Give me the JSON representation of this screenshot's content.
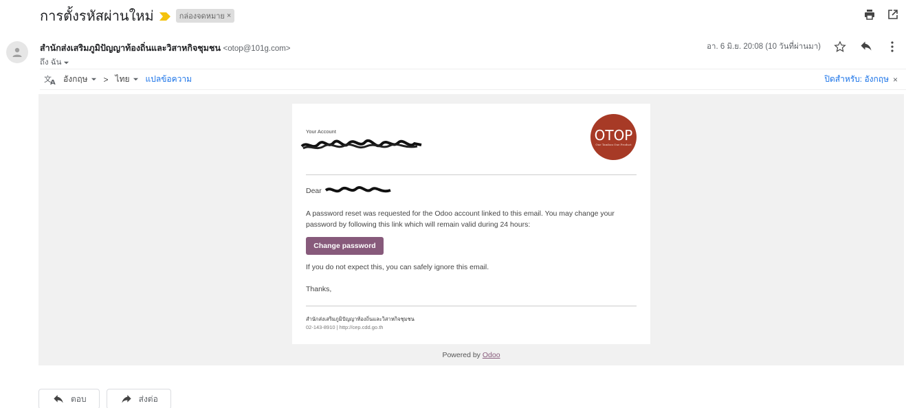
{
  "subject": "การตั้งรหัสผ่านใหม่",
  "label_chip": {
    "text": "กล่องจดหมาย",
    "close": "×"
  },
  "sender": {
    "name": "สำนักส่งเสริมภูมิปัญญาท้องถิ่นและวิสาหกิจชุมชน",
    "email": "<otop@101g.com>",
    "to": "ถึง ฉัน"
  },
  "date": "อา. 6 มิ.ย. 20:08 (10 วันที่ผ่านมา)",
  "translate": {
    "from_lang": "อังกฤษ",
    "arrow": ">",
    "to_lang": "ไทย",
    "action": "แปลข้อความ",
    "turn_off": "ปิดสำหรับ: อังกฤษ",
    "close": "×"
  },
  "email_body": {
    "account_label": "Your Account",
    "logo_text": "OTOP",
    "logo_subtext": "One Tambon One Product",
    "dear": "Dear",
    "paragraph": "A password reset was requested for the Odoo account linked to this email. You may change your password by following this link which will remain valid during 24 hours:",
    "button": "Change password",
    "ignore": "If you do not expect this, you can safely ignore this email.",
    "thanks": "Thanks,",
    "footer_org": "สำนักส่งเสริมภูมิปัญญาท้องถิ่นและวิสาหกิจชุมชน",
    "footer_contact": "02-143-8910 | http://cep.cdd.go.th",
    "powered_prefix": "Powered by",
    "powered_link": "Odoo"
  },
  "actions": {
    "reply": "ตอบ",
    "forward": "ส่งต่อ"
  },
  "colors": {
    "odoo_purple": "#875a7b",
    "otop_red": "#a73a26",
    "link_blue": "#1a73e8",
    "important_marker": "#f4c20d",
    "frame_gray": "#f1f1f1"
  },
  "icons": [
    "important-icon",
    "print-icon",
    "open-new-window-icon",
    "avatar-person-icon",
    "dropdown-icon",
    "star-icon",
    "reply-icon",
    "more-vert-icon",
    "translate-icon",
    "forward-icon"
  ]
}
